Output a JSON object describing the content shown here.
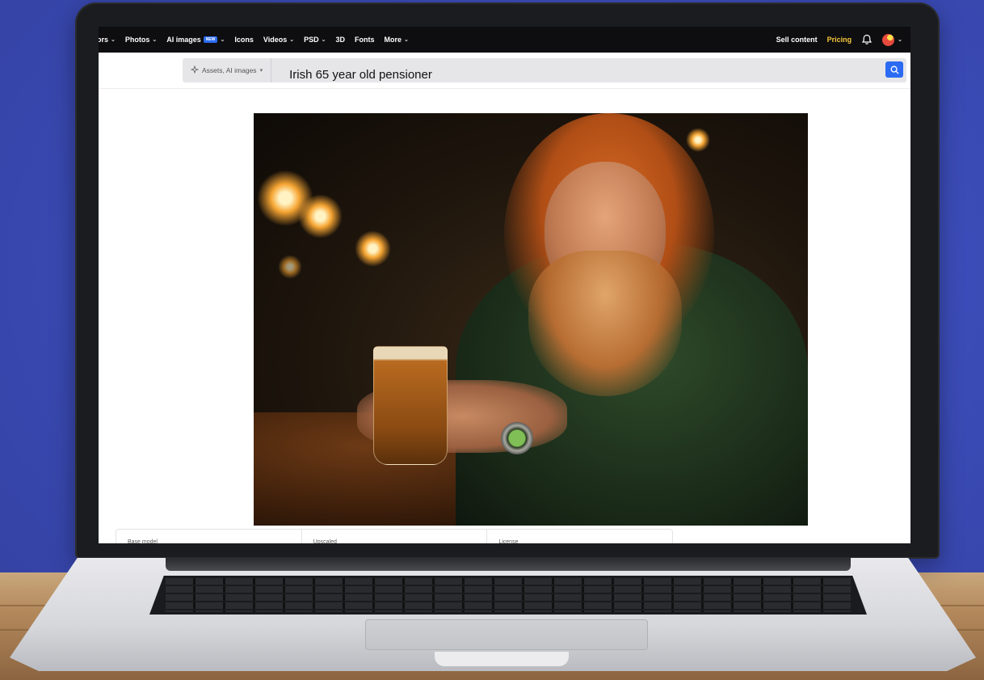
{
  "nav": {
    "items": [
      {
        "label": "ors",
        "has_dropdown": true
      },
      {
        "label": "Photos",
        "has_dropdown": true
      },
      {
        "label": "AI images",
        "badge": "NEW",
        "has_dropdown": true
      },
      {
        "label": "Icons",
        "has_dropdown": false
      },
      {
        "label": "Videos",
        "has_dropdown": true
      },
      {
        "label": "PSD",
        "has_dropdown": true
      },
      {
        "label": "3D",
        "has_dropdown": false
      },
      {
        "label": "Fonts",
        "has_dropdown": false
      },
      {
        "label": "More",
        "has_dropdown": true
      }
    ],
    "sell_content": "Sell content",
    "pricing": "Pricing",
    "icons": {
      "bell": "bell-icon",
      "avatar": "avatar"
    }
  },
  "search": {
    "asset_filter": "Assets, AI images",
    "query": "Irish 65 year old pensioner",
    "icons": {
      "filter": "sparkle-icon",
      "submit": "search-icon"
    }
  },
  "image": {
    "alt": "Irish 65 year old pensioner"
  },
  "info": {
    "cells": [
      "Base model",
      "Upscaled",
      "License"
    ]
  },
  "colors": {
    "background": "#3b4cb8",
    "nav_bg": "#0e0e10",
    "accent_blue": "#2b6bf3",
    "pricing_yellow": "#f7c83a"
  }
}
